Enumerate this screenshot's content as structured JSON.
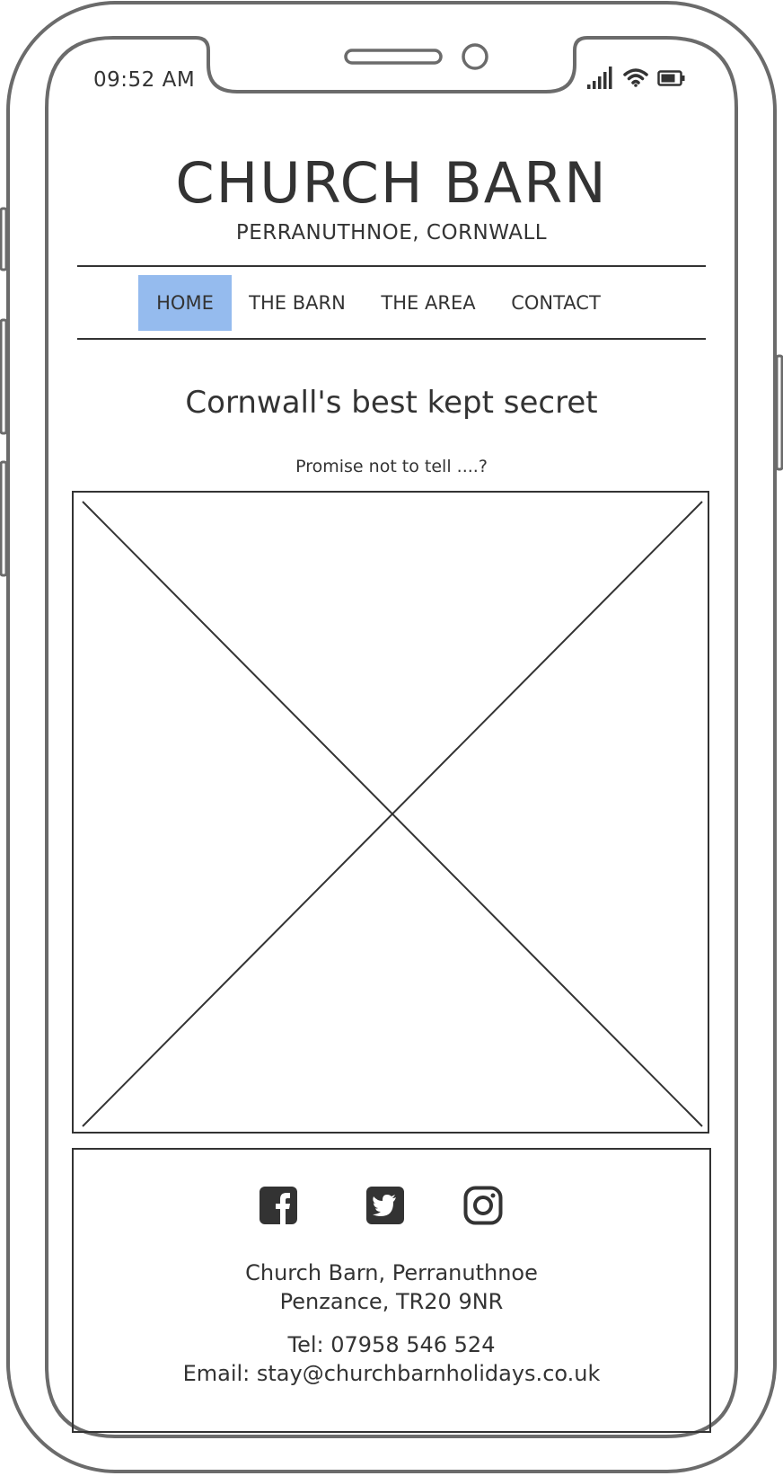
{
  "status_bar": {
    "time": "09:52 AM",
    "signal_icon": "signal-bars-icon",
    "wifi_icon": "wifi-icon",
    "battery_icon": "battery-icon"
  },
  "header": {
    "title": "CHURCH BARN",
    "subtitle": "PERRANUTHNOE, CORNWALL"
  },
  "nav": {
    "items": [
      {
        "label": "HOME",
        "active": true
      },
      {
        "label": "THE BARN",
        "active": false
      },
      {
        "label": "THE AREA",
        "active": false
      },
      {
        "label": "CONTACT",
        "active": false
      }
    ],
    "active_color": "#95bbee"
  },
  "main": {
    "headline": "Cornwall's best kept secret",
    "tagline": "Promise not to tell ....?"
  },
  "footer": {
    "social": [
      {
        "icon": "facebook-icon"
      },
      {
        "icon": "twitter-icon"
      },
      {
        "icon": "instagram-icon"
      }
    ],
    "address_line1": "Church Barn, Perranuthnoe",
    "address_line2": "Penzance, TR20 9NR",
    "phone": "Tel: 07958 546 524",
    "email": "Email: stay@churchbarnholidays.co.uk"
  },
  "colors": {
    "ink": "#333333",
    "frame": "#6b6b6b"
  }
}
